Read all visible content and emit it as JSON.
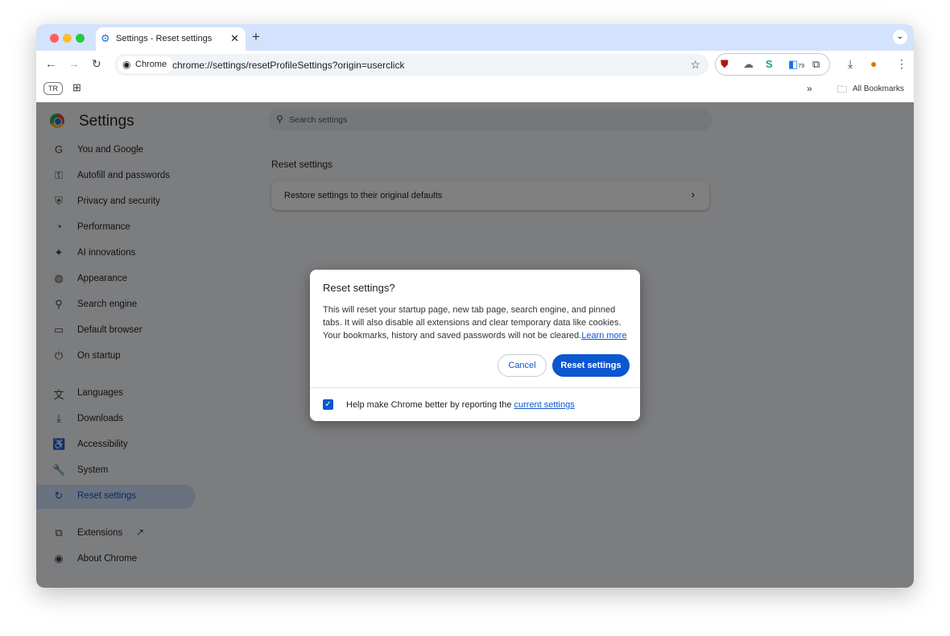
{
  "browser": {
    "tab_title": "Settings - Reset settings",
    "chip_label": "Chrome",
    "url": "chrome://settings/resetProfileSettings?origin=userclick",
    "profile": "TR",
    "extension_badge": "79",
    "bookmarks_label": "All Bookmarks",
    "more_bookmarks": "»"
  },
  "settings": {
    "title": "Settings",
    "search_placeholder": "Search settings",
    "section_title": "Reset settings",
    "card_label": "Restore settings to their original defaults"
  },
  "sidebar": {
    "items": [
      {
        "label": "You and Google",
        "icon": "G"
      },
      {
        "label": "Autofill and passwords",
        "icon": "⚿"
      },
      {
        "label": "Privacy and security",
        "icon": "⛨"
      },
      {
        "label": "Performance",
        "icon": "◔"
      },
      {
        "label": "AI innovations",
        "icon": "✦"
      },
      {
        "label": "Appearance",
        "icon": "◍"
      },
      {
        "label": "Search engine",
        "icon": "⚲"
      },
      {
        "label": "Default browser",
        "icon": "▭"
      },
      {
        "label": "On startup",
        "icon": "⏻"
      },
      {
        "label": "Languages",
        "icon": "文"
      },
      {
        "label": "Downloads",
        "icon": "⤓"
      },
      {
        "label": "Accessibility",
        "icon": "♿"
      },
      {
        "label": "System",
        "icon": "🔧"
      },
      {
        "label": "Reset settings",
        "icon": "↻"
      },
      {
        "label": "Extensions",
        "icon": "⧉"
      },
      {
        "label": "About Chrome",
        "icon": "◉"
      }
    ]
  },
  "dialog": {
    "title": "Reset settings?",
    "body": "This will reset your startup page, new tab page, search engine, and pinned tabs. It will also disable all extensions and clear temporary data like cookies. Your bookmarks, history and saved passwords will not be cleared.",
    "learn_more": "Learn more",
    "cancel": "Cancel",
    "reset": "Reset settings",
    "checkbox_label": "Help make Chrome better by reporting the ",
    "checkbox_link": "current settings",
    "checkbox_checked": true
  },
  "colors": {
    "accent": "#0b57d0",
    "tabbar": "#d3e3fd"
  }
}
